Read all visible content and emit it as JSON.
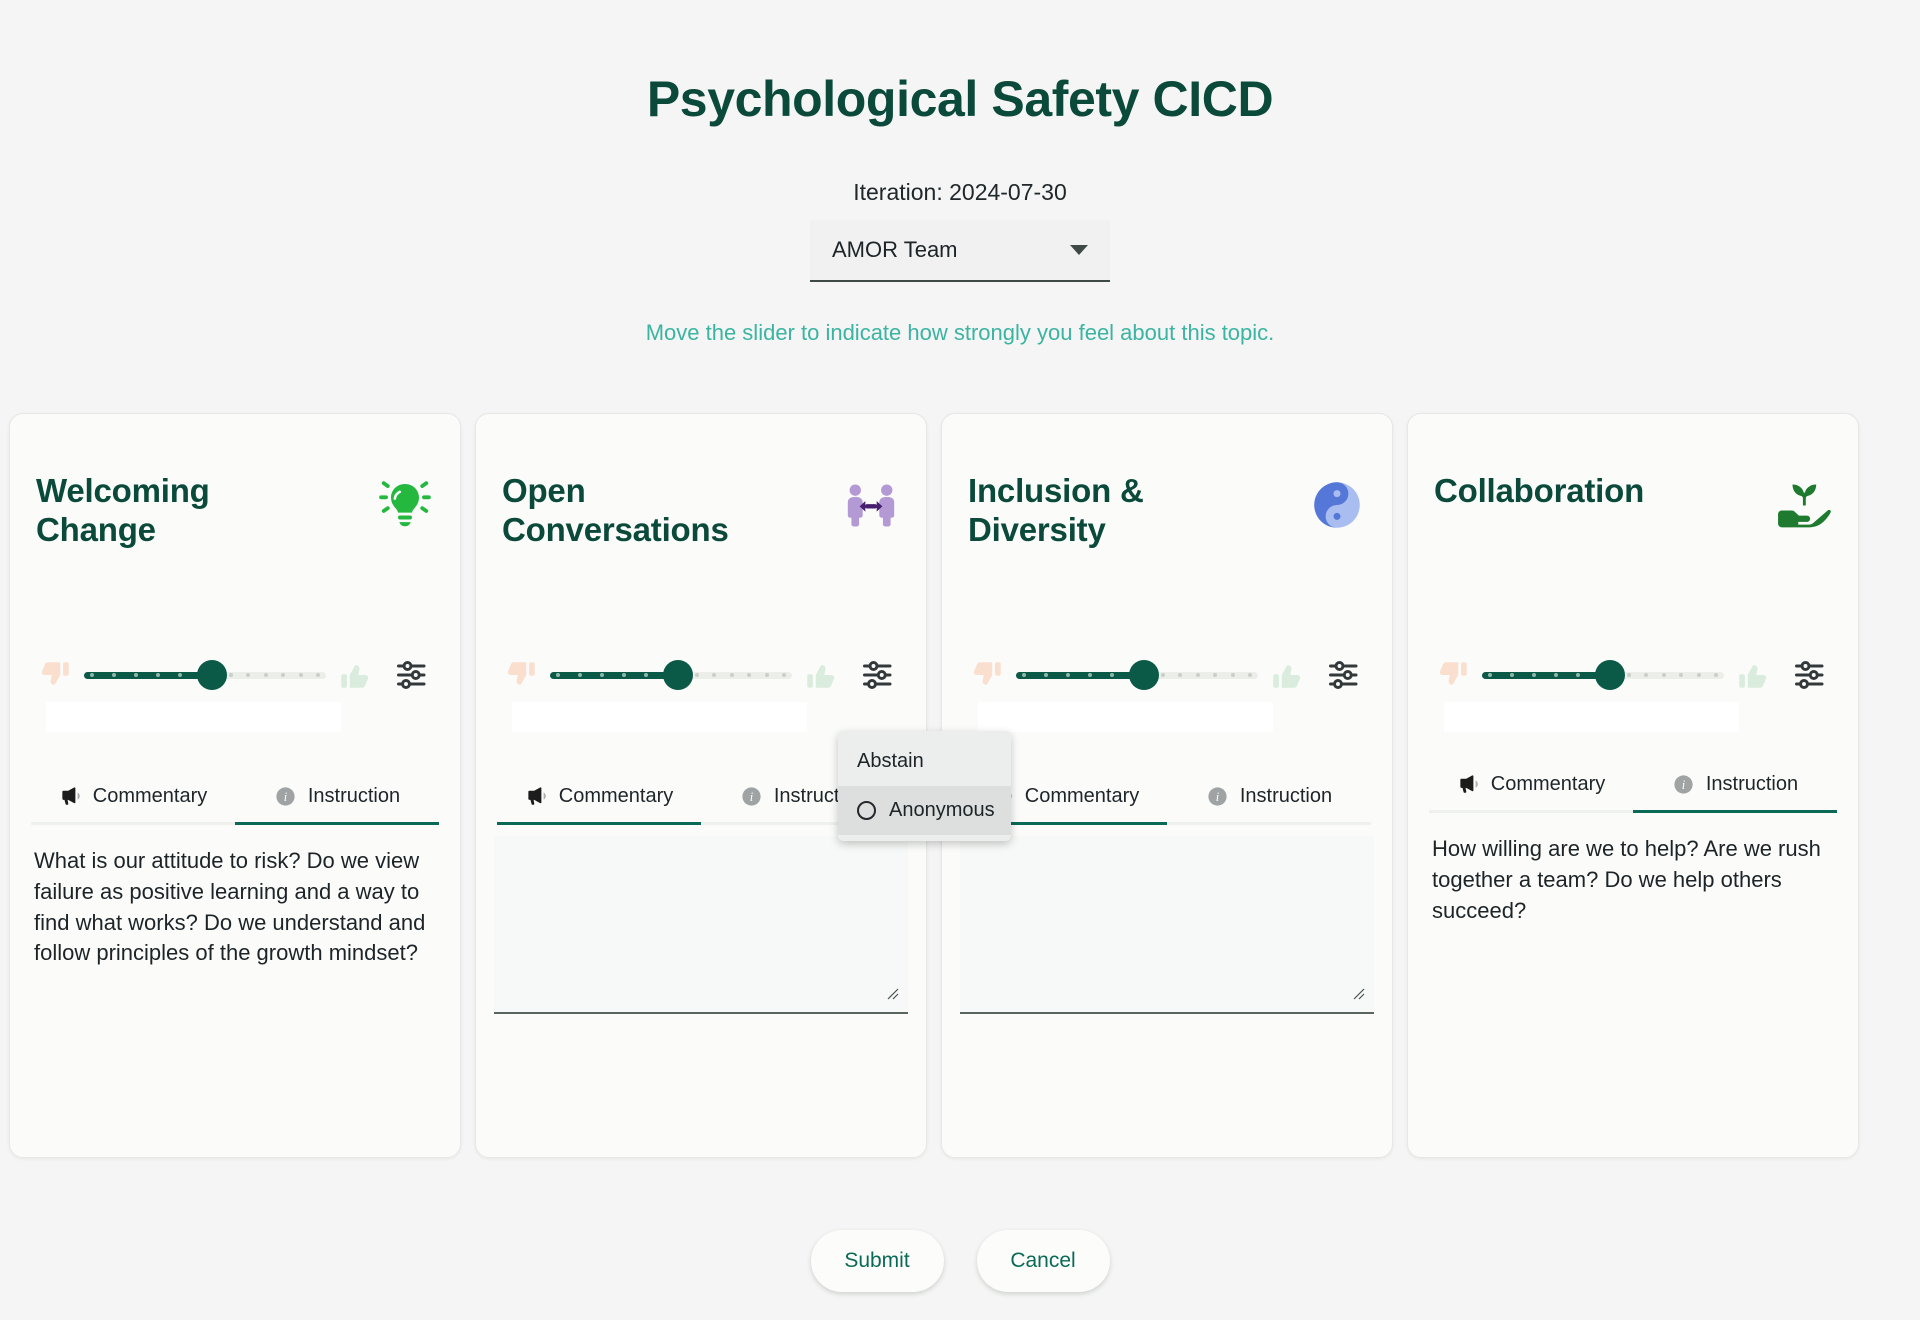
{
  "header": {
    "title": "Psychological Safety CICD",
    "iteration_label": "Iteration: 2024-07-30",
    "team_value": "AMOR Team",
    "hint": "Move the slider to indicate how strongly you feel about this topic."
  },
  "tabs_common": {
    "commentary_label": "Commentary",
    "instruction_label": "Instruction"
  },
  "popup": {
    "items": [
      {
        "label": "Abstain",
        "radio": false
      },
      {
        "label": "Anonymous",
        "radio": true
      }
    ]
  },
  "footer": {
    "submit_label": "Submit",
    "cancel_label": "Cancel"
  },
  "colors": {
    "brand_green": "#0b4a3a",
    "accent_teal": "#3bb4a2",
    "slider_fill": "#0b5a48",
    "tab_active": "#0a6a55",
    "page_bg": "#f4f5f4",
    "card_bg": "#fbfcfa"
  },
  "cards": [
    {
      "title": "Welcoming Change",
      "icon": "lightbulb-icon",
      "icon_color": "#25b83f",
      "slider_value": 52,
      "active_tab": "instruction",
      "instruction": "What is our attitude to risk? Do we view failure as positive learning and a way to find what works? Do we understand and follow principles of the growth mindset?",
      "commentary_value": ""
    },
    {
      "title": "Open Conversations",
      "icon": "two-people-icon",
      "icon_color": "#b39ad4",
      "slider_value": 52,
      "active_tab": "commentary",
      "instruction": "",
      "commentary_value": ""
    },
    {
      "title": "Inclusion & Diversity",
      "icon": "yin-yang-icon",
      "icon_color": "#5578d8",
      "slider_value": 52,
      "active_tab": "commentary",
      "instruction": "",
      "commentary_value": ""
    },
    {
      "title": "Collaboration",
      "icon": "hand-sprout-icon",
      "icon_color": "#1d7a2e",
      "slider_value": 52,
      "active_tab": "instruction",
      "instruction": "How willing are we to help? Are we rush together a team? Do we help others succeed?",
      "commentary_value": ""
    }
  ]
}
